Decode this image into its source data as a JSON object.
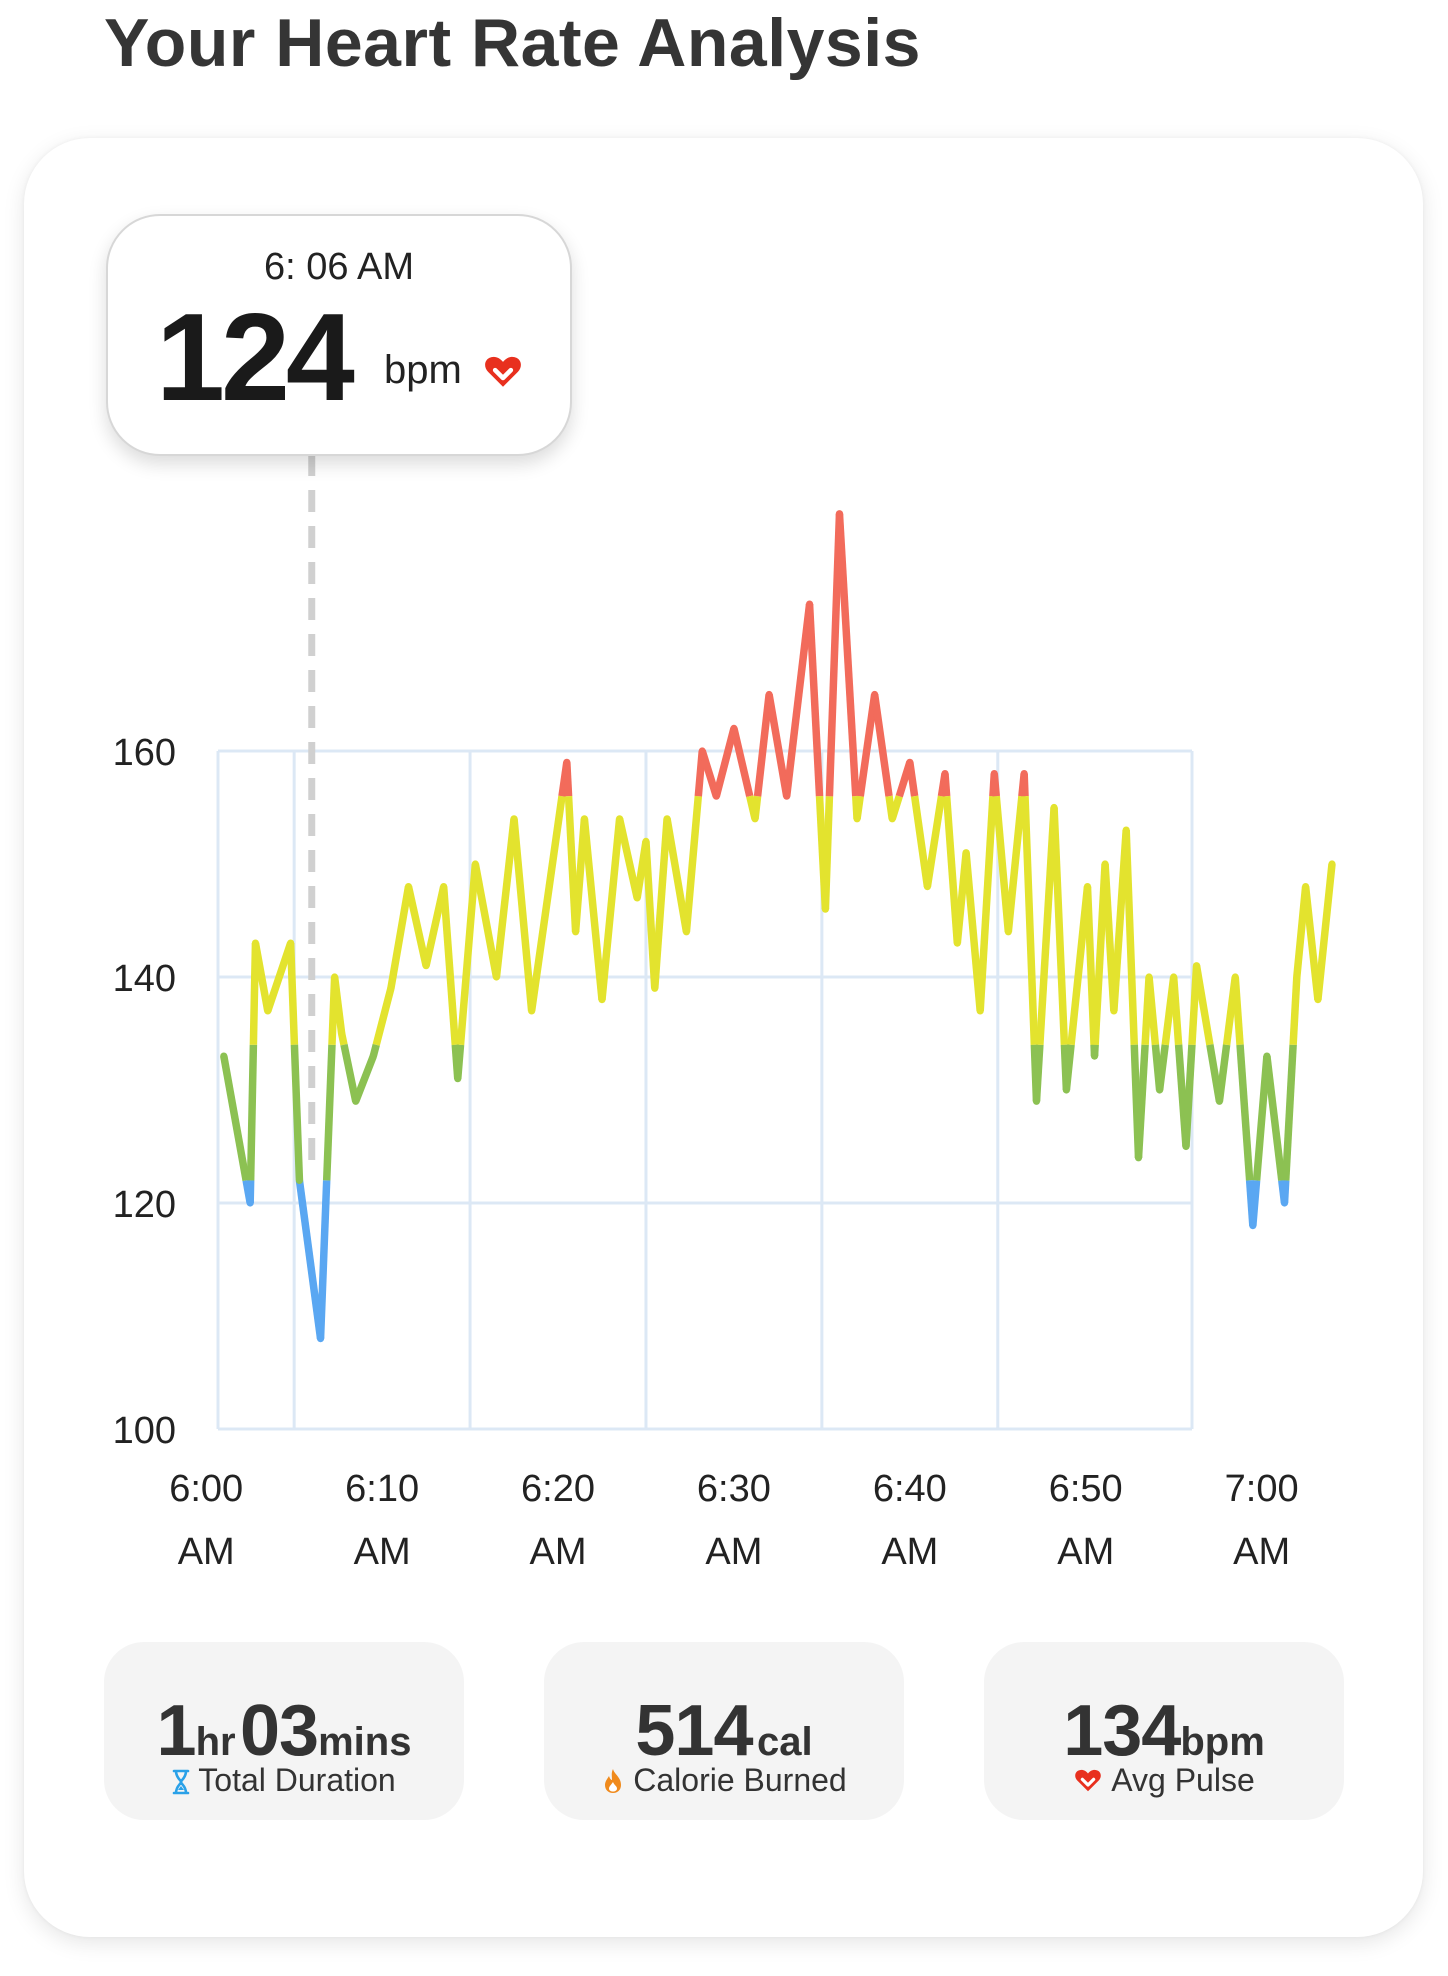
{
  "page": {
    "title": "Your Heart Rate Analysis"
  },
  "tooltip": {
    "time": "6: 06 AM",
    "value": "124",
    "unit": "bpm",
    "icon": "heart-icon"
  },
  "stats": {
    "duration": {
      "hours": "1",
      "hours_unit": "hr",
      "minutes": "03",
      "minutes_unit": "mins",
      "label": "Total Duration",
      "icon": "hourglass-icon"
    },
    "calories": {
      "value": "514",
      "unit": "cal",
      "label": "Calorie Burned",
      "icon": "flame-icon"
    },
    "pulse": {
      "value": "134",
      "unit": "bpm",
      "label": "Avg Pulse",
      "icon": "heart-icon"
    }
  },
  "colors": {
    "low": "#5aa7f2",
    "normal": "#8cc152",
    "moderate": "#e3e32e",
    "high": "#f26b5b",
    "grid": "#dce8f5",
    "cursor": "#d0d0d0",
    "heart": "#e8301e",
    "flame": "#f08a1c",
    "hourglass": "#2aa1e8"
  },
  "chart_data": {
    "type": "line",
    "title": "",
    "xlabel": "",
    "ylabel": "",
    "ylim": [
      100,
      178
    ],
    "yticks": [
      100,
      120,
      140,
      160
    ],
    "xlim": [
      5.5,
      69
    ],
    "xticks": [
      {
        "value": 5,
        "line1": "6:00",
        "line2": "AM"
      },
      {
        "value": 15,
        "line1": "6:10",
        "line2": "AM"
      },
      {
        "value": 25,
        "line1": "6:20",
        "line2": "AM"
      },
      {
        "value": 35,
        "line1": "6:30",
        "line2": "AM"
      },
      {
        "value": 45,
        "line1": "6:40",
        "line2": "AM"
      },
      {
        "value": 55,
        "line1": "6:50",
        "line2": "AM"
      },
      {
        "value": 65,
        "line1": "7:00",
        "line2": "AM"
      }
    ],
    "zones": {
      "low_below": 122,
      "normal_below": 134,
      "moderate_below": 156
    },
    "cursor_x": 11,
    "x_unit": "minutes after 5:55 AM",
    "series": [
      {
        "x": [
          6,
          7.5,
          7.8,
          8.5,
          9.8,
          10.3,
          11.5,
          12.3,
          12.7,
          13.5,
          14.5,
          15.5,
          16.5,
          17.5,
          18.5,
          19.3,
          20.3,
          21.5,
          22.5,
          23.5,
          24.5,
          25.5,
          26,
          26.5,
          27.5,
          28.5,
          29.5,
          30,
          30.5,
          31.2,
          32.3,
          33.2,
          34,
          35,
          36.2,
          37,
          38,
          39.3,
          40.2,
          41,
          42,
          43,
          44,
          45,
          46,
          47,
          47.7,
          48.2,
          49,
          49.8,
          50.6,
          51.5,
          52.2,
          53.2,
          53.9,
          55.1,
          55.5,
          56.1,
          56.6,
          57.3,
          58,
          58.6,
          59.2,
          60,
          60.7,
          61.3,
          62.6,
          63.5,
          64.5,
          65.3,
          66.3,
          67,
          67.5,
          68.2,
          69
        ],
        "y": [
          133,
          120,
          143,
          137,
          143,
          122,
          108,
          140,
          135,
          129,
          133,
          139,
          148,
          141,
          148,
          131,
          150,
          140,
          154,
          137,
          148,
          159,
          144,
          154,
          138,
          154,
          147,
          152,
          139,
          154,
          144,
          160,
          156,
          162,
          154,
          165,
          156,
          173,
          146,
          181,
          154,
          165,
          154,
          159,
          148,
          158,
          143,
          151,
          137,
          158,
          144,
          158,
          129,
          155,
          130,
          148,
          133,
          150,
          137,
          153,
          124,
          140,
          130,
          140,
          125,
          141,
          129,
          140,
          118,
          133,
          120,
          140,
          148,
          138,
          150
        ]
      }
    ]
  }
}
